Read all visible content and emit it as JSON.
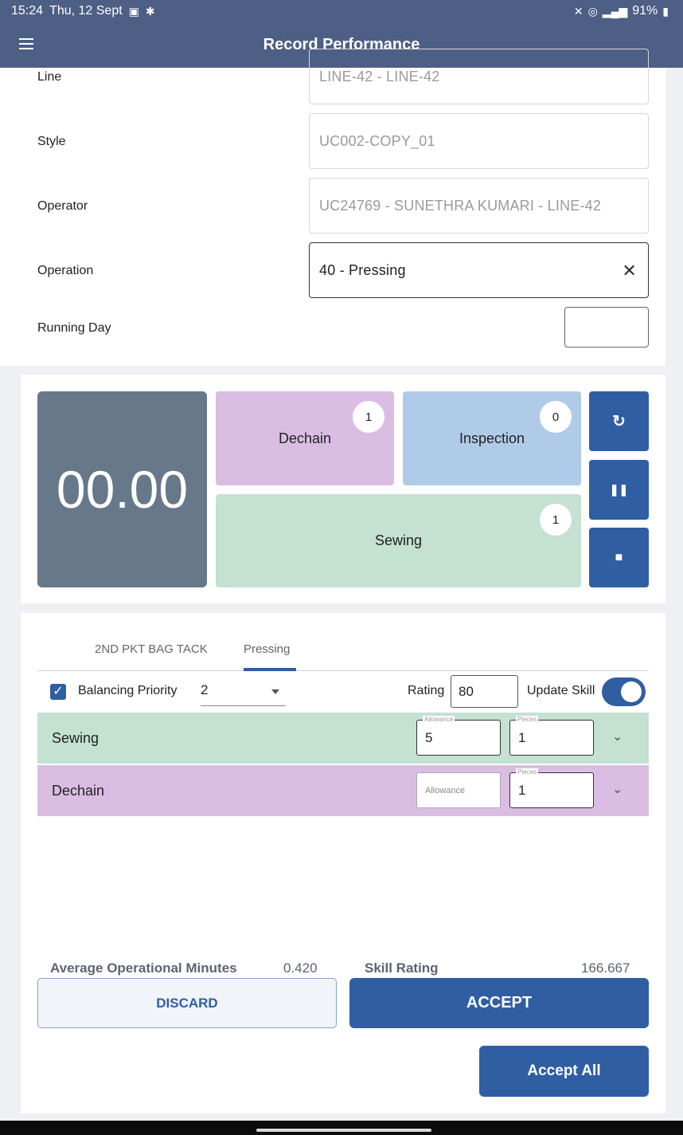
{
  "status_bar": {
    "time": "15:24",
    "date": "Thu, 12 Sept",
    "battery": "91%",
    "icons": [
      "image-icon",
      "accessibility-icon",
      "mute-icon",
      "hotspot-icon",
      "signal-icon",
      "battery-icon"
    ]
  },
  "app_bar": {
    "title": "Record Performance",
    "menu_icon": "menu-icon"
  },
  "form": {
    "line": {
      "label": "Line",
      "value": "LINE-42 - LINE-42"
    },
    "style": {
      "label": "Style",
      "value": "UC002-COPY_01"
    },
    "operator": {
      "label": "Operator",
      "value": "UC24769 - SUNETHRA  KUMARI - LINE-42"
    },
    "operation": {
      "label": "Operation",
      "value": "40 - Pressing"
    },
    "running_day": {
      "label": "Running Day",
      "value": ""
    }
  },
  "timer": {
    "value": "00.00"
  },
  "counters": {
    "dechain": {
      "label": "Dechain",
      "count": "1"
    },
    "inspection": {
      "label": "Inspection",
      "count": "0"
    },
    "sewing": {
      "label": "Sewing",
      "count": "1"
    }
  },
  "controls": {
    "reset_glyph": "↻",
    "pause_glyph": "❚❚",
    "stop_glyph": "■"
  },
  "tabs": [
    {
      "label": "2ND PKT BAG TACK",
      "active": false
    },
    {
      "label": "Pressing",
      "active": true
    }
  ],
  "options": {
    "balancing_priority_label": "Balancing Priority",
    "balancing_priority_checked": true,
    "balancing_priority_value": "2",
    "rating_label": "Rating",
    "rating_value": "80",
    "update_skill_label": "Update Skill",
    "update_skill_on": true
  },
  "operations": [
    {
      "name": "Sewing",
      "allowance_legend": "Allowance",
      "allowance_value": "5",
      "pieces_legend": "Pieces",
      "pieces_value": "1"
    },
    {
      "name": "Dechain",
      "allowance_placeholder": "Allowance",
      "allowance_value": "",
      "pieces_legend": "Pieces",
      "pieces_value": "1"
    }
  ],
  "summary": {
    "avg_minutes_label": "Average Operational Minutes",
    "avg_minutes_value": "0.420",
    "skill_rating_label": "Skill Rating",
    "skill_rating_value": "166.667"
  },
  "buttons": {
    "discard": "DISCARD",
    "accept": "ACCEPT",
    "accept_all": "Accept All"
  },
  "colors": {
    "header": "#4e5f86",
    "primary": "#2f5ea3",
    "timer_bg": "#66788a",
    "dechain": "#dbbde3",
    "inspection": "#b0cbe8",
    "sewing": "#c4e1d2"
  }
}
